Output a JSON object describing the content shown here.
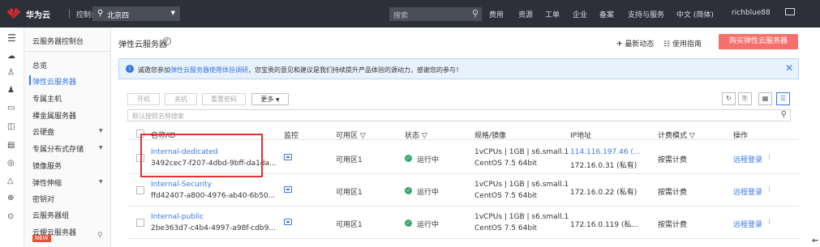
{
  "topbar": {
    "brand": "华为云",
    "console": "控制台",
    "region": "北京四",
    "search_placeholder": "搜索",
    "links": [
      "费用",
      "资源",
      "工单",
      "企业",
      "备案",
      "支持与服务",
      "中文 (简体)",
      "richblue88"
    ],
    "icons": [
      "huawei-logo-icon",
      "location-pin-icon",
      "search-icon",
      "mail-icon"
    ]
  },
  "rail_icons": [
    "menu-icon",
    "cloud-icon",
    "people-icon",
    "group-icon",
    "server-icon",
    "disk-icon",
    "layers-icon",
    "db-icon",
    "cluster-icon",
    "globe-icon",
    "target-icon"
  ],
  "sidebar": {
    "header": "云服务器控制台",
    "items": [
      {
        "label": "总览"
      },
      {
        "label": "弹性云服务器",
        "active": true
      },
      {
        "label": "专属主机"
      },
      {
        "label": "裸金属服务器"
      },
      {
        "label": "云硬盘",
        "expandable": true
      },
      {
        "label": "专属分布式存储",
        "expandable": true
      },
      {
        "label": "镜像服务"
      },
      {
        "label": "弹性伸缩",
        "expandable": true
      },
      {
        "label": "密钥对"
      },
      {
        "label": "云服务器组"
      },
      {
        "label": "云耀云服务器",
        "badge": "NEW"
      }
    ]
  },
  "page": {
    "title": "弹性云服务器",
    "latest_news": "最新动态",
    "guide": "使用指南",
    "buy_button": "购买弹性云服务器",
    "notice_prefix": "诚邀您参加",
    "notice_link": "弹性云服务器使用体验调研",
    "notice_suffix": "，您宝贵的意见和建议是我们持续提升产品体验的源动力，感谢您的参与！"
  },
  "toolbar": {
    "start": "开机",
    "stop": "关机",
    "reset_password": "重置密码",
    "more": "更多"
  },
  "filter_placeholder": "默认按照名称搜索",
  "table": {
    "headers": {
      "name": "名称/ID",
      "monitor": "监控",
      "az": "可用区",
      "status": "状态",
      "spec": "规格/镜像",
      "ip": "IP地址",
      "billing": "计费模式",
      "ops": "操作"
    },
    "rows": [
      {
        "name": "Internal-dedicated",
        "id": "3492cec7-f207-4dbd-9bff-da1da...",
        "az": "可用区1",
        "status": "运行中",
        "spec": "1vCPUs | 1GB | s6.small.1",
        "image": "CentOS 7.5 64bit",
        "ip_public": "114.116.197.46 (...",
        "ip_private": "172.16.0.31 (私有)",
        "billing": "按需计费",
        "op": "远程登录"
      },
      {
        "name": "Internal-Security",
        "id": "ffd42407-a800-4976-ab40-6b50...",
        "az": "可用区1",
        "status": "运行中",
        "spec": "1vCPUs | 1GB | s6.small.1",
        "image": "CentOS 7.5 64bit",
        "ip_private": "172.16.0.22 (私有)",
        "billing": "按需计费",
        "op": "远程登录"
      },
      {
        "name": "Internal-public",
        "id": "2be363d7-c4b4-4997-a98f-cdb9...",
        "az": "可用区1",
        "status": "运行中",
        "spec": "1vCPUs | 1GB | s6.small.1",
        "image": "CentOS 7.5 64bit",
        "ip_private": "172.16.0.119 (私...",
        "billing": "按需计费",
        "op": "远程登录"
      }
    ]
  },
  "colors": {
    "accent": "#3a77e6",
    "buy": "#f66f6a",
    "ok": "#3aa76d",
    "highlight": "#e03030",
    "topbar": "#2d3038"
  }
}
